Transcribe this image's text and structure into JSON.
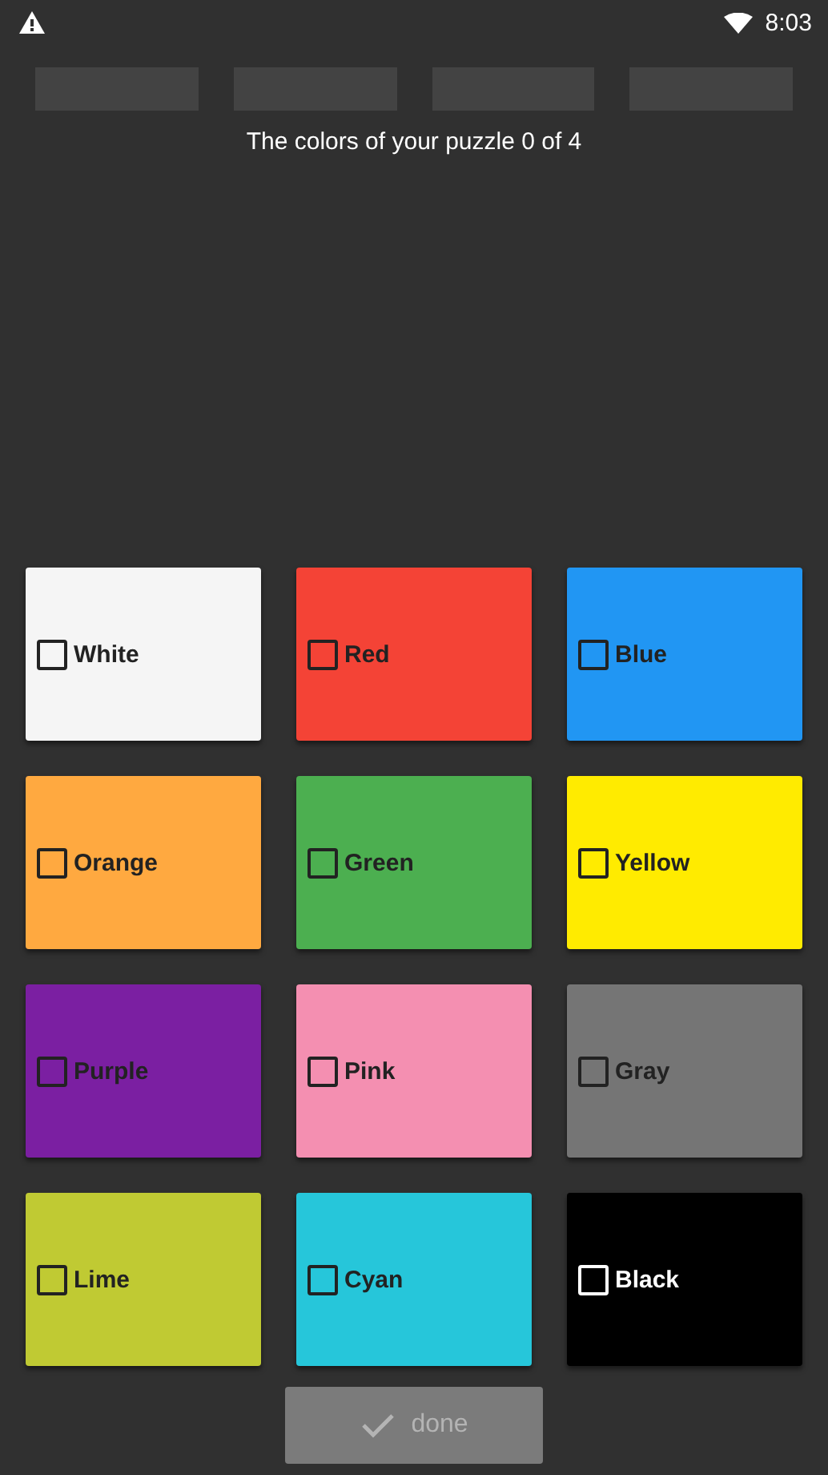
{
  "status_bar": {
    "time": "8:03"
  },
  "slots": [
    {
      "filled": false
    },
    {
      "filled": false
    },
    {
      "filled": false
    },
    {
      "filled": false
    }
  ],
  "title": "The colors of your puzzle 0 of 4",
  "colors": [
    {
      "label": "White",
      "color": "#f5f5f5",
      "checked": false
    },
    {
      "label": "Red",
      "color": "#f44336",
      "checked": false
    },
    {
      "label": "Blue",
      "color": "#2196f3",
      "checked": false
    },
    {
      "label": "Orange",
      "color": "#ffa940",
      "checked": false
    },
    {
      "label": "Green",
      "color": "#4caf50",
      "checked": false
    },
    {
      "label": "Yellow",
      "color": "#ffeb00",
      "checked": false
    },
    {
      "label": "Purple",
      "color": "#7b1fa2",
      "checked": false
    },
    {
      "label": "Pink",
      "color": "#f48fb1",
      "checked": false
    },
    {
      "label": "Gray",
      "color": "#757575",
      "checked": false
    },
    {
      "label": "Lime",
      "color": "#c0ca33",
      "checked": false
    },
    {
      "label": "Cyan",
      "color": "#26c6da",
      "checked": false
    },
    {
      "label": "Black",
      "color": "#000000",
      "checked": false
    }
  ],
  "done_button": {
    "label": "done",
    "disabled": true
  }
}
